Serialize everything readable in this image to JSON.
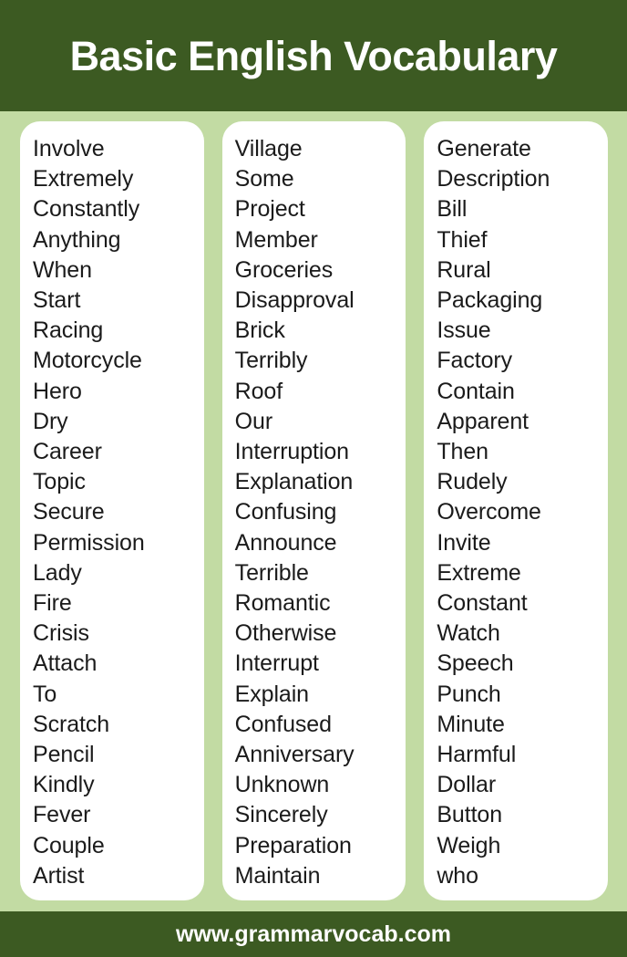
{
  "header": {
    "title": "Basic English Vocabulary"
  },
  "footer": {
    "website": "www.grammarvocab.com"
  },
  "colors": {
    "dark_green": "#3c5a22",
    "light_green": "#c2dba3",
    "card_background": "#ffffff",
    "word_text": "#1b1b1b",
    "header_text": "#ffffff"
  },
  "columns": [
    {
      "id": "column-1",
      "words": [
        "Involve",
        "Extremely",
        "Constantly",
        "Anything",
        "When",
        "Start",
        "Racing",
        "Motorcycle",
        "Hero",
        "Dry",
        "Career",
        "Topic",
        "Secure",
        "Permission",
        "Lady",
        "Fire",
        "Crisis",
        "Attach",
        "To",
        "Scratch",
        "Pencil",
        "Kindly",
        "Fever",
        "Couple",
        "Artist"
      ]
    },
    {
      "id": "column-2",
      "words": [
        "Village",
        "Some",
        "Project",
        "Member",
        "Groceries",
        "Disapproval",
        "Brick",
        "Terribly",
        "Roof",
        "Our",
        "Interruption",
        "Explanation",
        "Confusing",
        "Announce",
        "Terrible",
        "Romantic",
        "Otherwise",
        "Interrupt",
        "Explain",
        "Confused",
        "Anniversary",
        "Unknown",
        "Sincerely",
        "Preparation",
        "Maintain"
      ]
    },
    {
      "id": "column-3",
      "words": [
        "Generate",
        "Description",
        "Bill",
        "Thief",
        "Rural",
        "Packaging",
        "Issue",
        "Factory",
        "Contain",
        "Apparent",
        "Then",
        "Rudely",
        "Overcome",
        "Invite",
        "Extreme",
        "Constant",
        "Watch",
        "Speech",
        "Punch",
        "Minute",
        "Harmful",
        "Dollar",
        "Button",
        "Weigh",
        "who"
      ]
    }
  ]
}
